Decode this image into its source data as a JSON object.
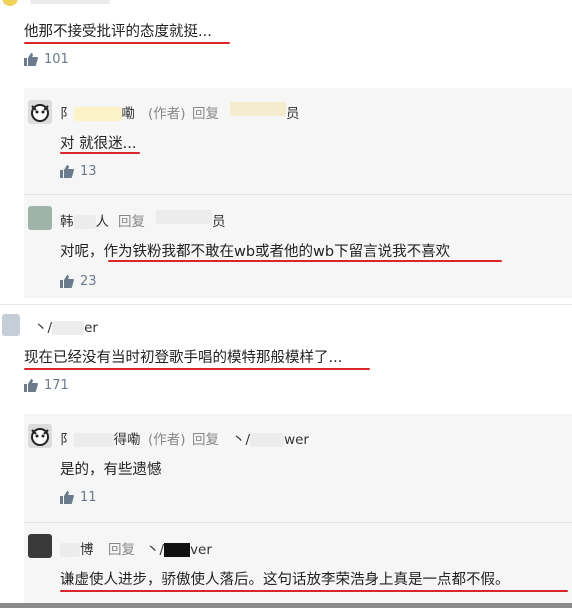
{
  "comments": [
    {
      "text": "他那不接受批评的态度就挺...",
      "likes": "101"
    },
    {
      "author": "阝",
      "author_tail": "嘞",
      "author_role": "(作者)",
      "reply_word": "回复",
      "target_tail": "员",
      "text": "对 就很迷...",
      "likes": "13"
    },
    {
      "author": "韩",
      "author_tail": "人",
      "reply_word": "回复",
      "target_tail": "员",
      "text": "对呢，作为铁粉我都不敢在wb或者他的wb下留言说我不喜欢",
      "likes": "23"
    },
    {
      "author": "丶/",
      "author_tail": "er",
      "text": "现在已经没有当时初登歌手唱的模特那般模样了...",
      "likes": "171"
    },
    {
      "author": "阝",
      "author_tail": "得嘞",
      "author_role": "(作者)",
      "reply_word": "回复",
      "target": "丶/",
      "target_tail": "wer",
      "text": "是的，有些遗憾",
      "likes": "11"
    },
    {
      "author": "博",
      "reply_word": "回复",
      "target": "丶/",
      "target_tail": "ver",
      "text": "谦虚使人进步，骄傲使人落后。这句话放李荣浩身上真是一点都不假。"
    }
  ],
  "colors": {
    "underline": "#d8262b",
    "like": "#6b7a8d"
  },
  "icons": {
    "like": "thumbs-up-icon"
  }
}
